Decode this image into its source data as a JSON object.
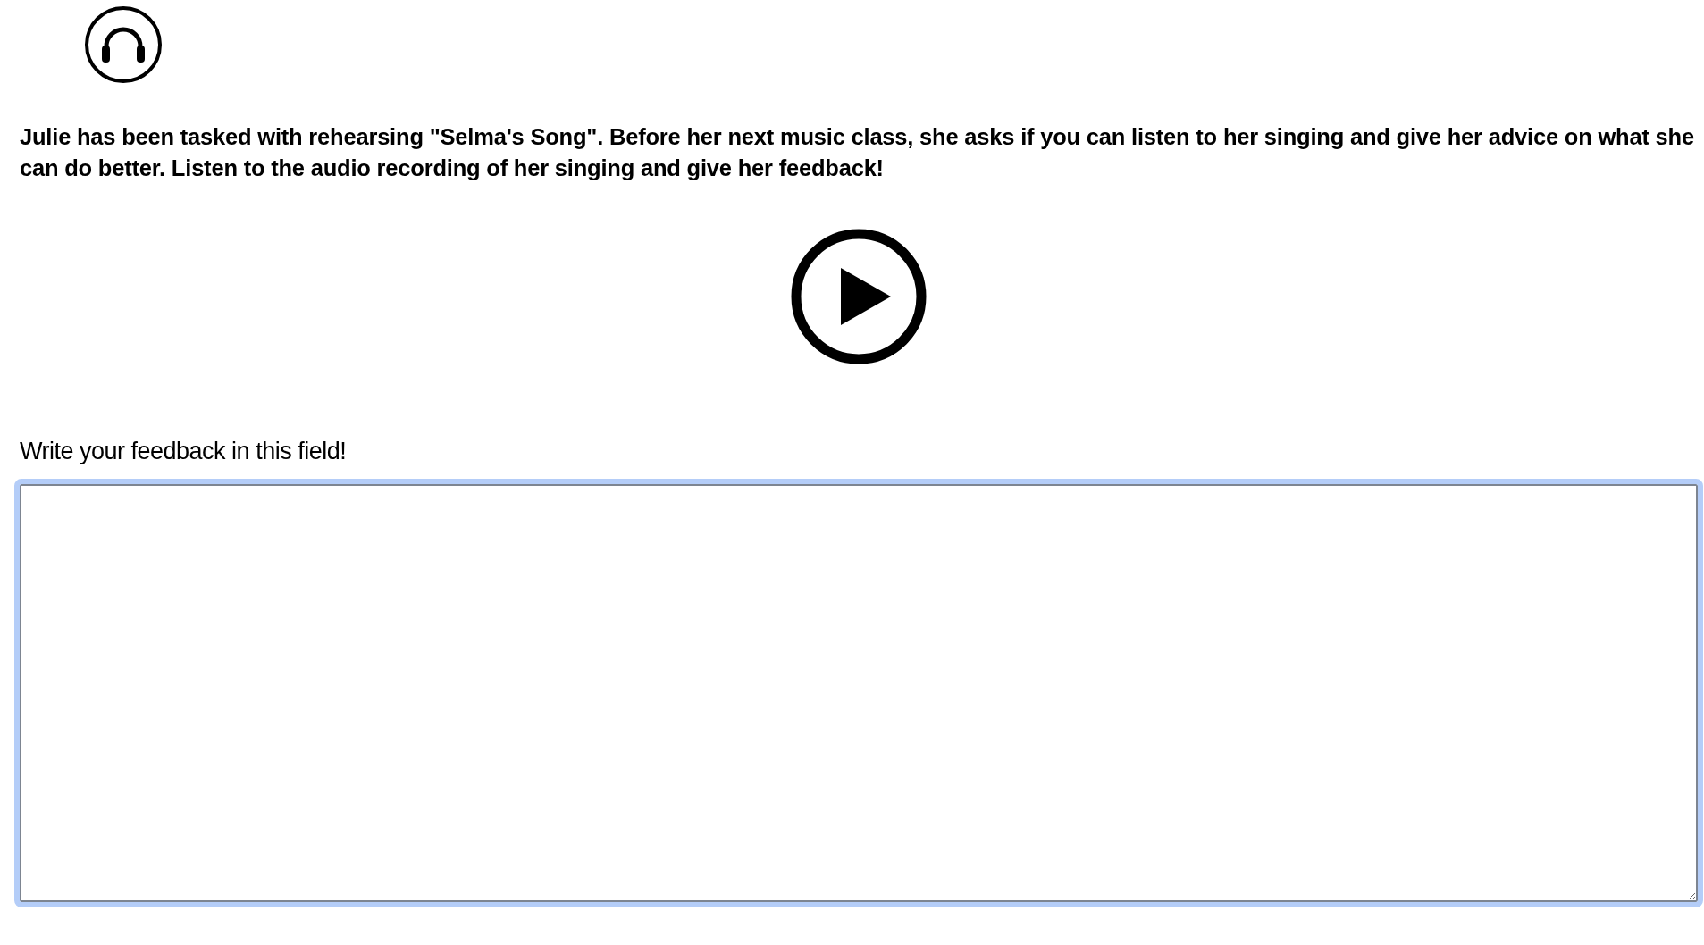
{
  "instructions": "Julie has been tasked with rehearsing \"Selma's Song\". Before her next music class, she asks if you can listen to her singing and give her advice on what she can do better. Listen to the audio recording of her singing and give her feedback!",
  "feedback": {
    "label": "Write your feedback in this field!",
    "focused": true
  }
}
